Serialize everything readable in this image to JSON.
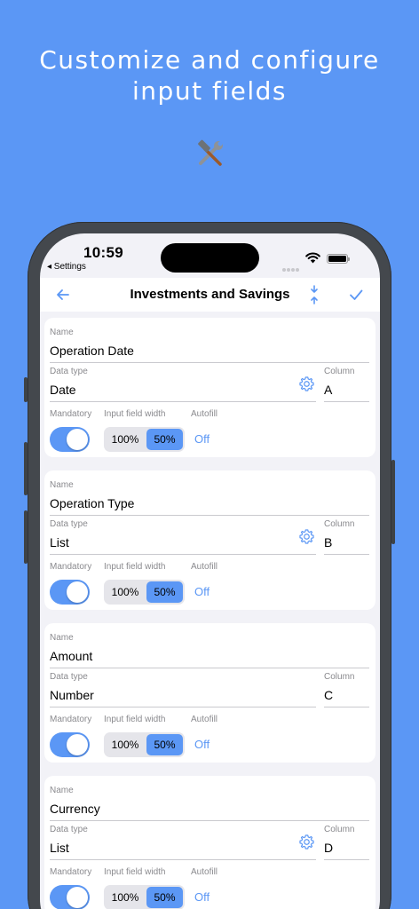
{
  "headline": {
    "line1": "Customize and configure",
    "line2": "input fields",
    "icon": "hammer-and-wrench-icon"
  },
  "status_bar": {
    "time": "10:59",
    "back_app": "◂ Settings"
  },
  "navbar": {
    "title": "Investments and Savings",
    "back_icon": "arrow-left-icon",
    "resize_icon": "vertical-resize-icon",
    "confirm_icon": "checkmark-icon"
  },
  "labels": {
    "name": "Name",
    "data_type": "Data type",
    "column": "Column",
    "mandatory": "Mandatory",
    "input_field_width": "Input field width",
    "autofill": "Autofill"
  },
  "width_options": [
    "100%",
    "50%"
  ],
  "fields": [
    {
      "name": "Operation Date",
      "data_type": "Date",
      "column": "A",
      "mandatory": true,
      "width": "50%",
      "autofill": "Off",
      "has_settings": true
    },
    {
      "name": "Operation Type",
      "data_type": "List",
      "column": "B",
      "mandatory": true,
      "width": "50%",
      "autofill": "Off",
      "has_settings": true
    },
    {
      "name": "Amount",
      "data_type": "Number",
      "column": "C",
      "mandatory": true,
      "width": "50%",
      "autofill": "Off",
      "has_settings": false
    },
    {
      "name": "Currency",
      "data_type": "List",
      "column": "D",
      "mandatory": true,
      "width": "50%",
      "autofill": "Off",
      "has_settings": true
    }
  ],
  "colors": {
    "background": "#5b97f5",
    "accent": "#5b97f5",
    "screen": "#f2f2f7"
  }
}
